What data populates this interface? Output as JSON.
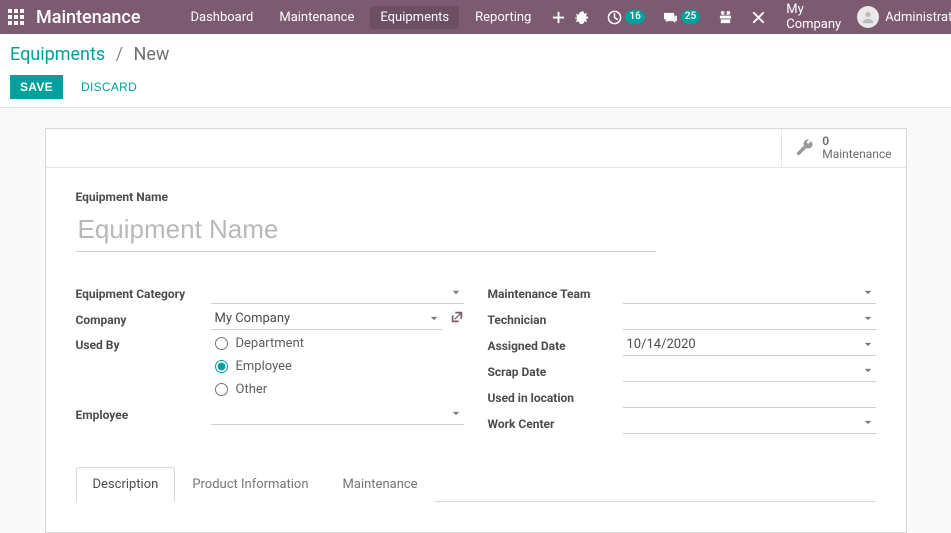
{
  "topbar": {
    "brand": "Maintenance",
    "menu": [
      {
        "key": "dashboard",
        "label": "Dashboard"
      },
      {
        "key": "maintenance",
        "label": "Maintenance"
      },
      {
        "key": "equipments",
        "label": "Equipments"
      },
      {
        "key": "reporting",
        "label": "Reporting"
      }
    ],
    "active_menu": "equipments",
    "badges": {
      "activities": "16",
      "discuss": "25"
    },
    "company": "My Company",
    "user": "Administrator"
  },
  "breadcrumb": {
    "parent": "Equipments",
    "current": "New"
  },
  "buttons": {
    "save": "SAVE",
    "discard": "DISCARD"
  },
  "stat": {
    "count": "0",
    "label": "Maintenance"
  },
  "form": {
    "title_label": "Equipment Name",
    "title_placeholder": "Equipment Name",
    "title_value": "",
    "left": {
      "category": {
        "label": "Equipment Category",
        "value": ""
      },
      "company": {
        "label": "Company",
        "value": "My Company"
      },
      "used_by": {
        "label": "Used By",
        "options": [
          "Department",
          "Employee",
          "Other"
        ],
        "selected": "Employee"
      },
      "employee": {
        "label": "Employee",
        "value": ""
      }
    },
    "right": {
      "team": {
        "label": "Maintenance Team",
        "value": ""
      },
      "technician": {
        "label": "Technician",
        "value": ""
      },
      "assigned_date": {
        "label": "Assigned Date",
        "value": "10/14/2020"
      },
      "scrap_date": {
        "label": "Scrap Date",
        "value": ""
      },
      "location": {
        "label": "Used in location",
        "value": ""
      },
      "work_center": {
        "label": "Work Center",
        "value": ""
      }
    },
    "tabs": [
      "Description",
      "Product Information",
      "Maintenance"
    ],
    "active_tab": 0
  },
  "colors": {
    "primary": "#7c5a6f",
    "accent": "#00a09d"
  }
}
